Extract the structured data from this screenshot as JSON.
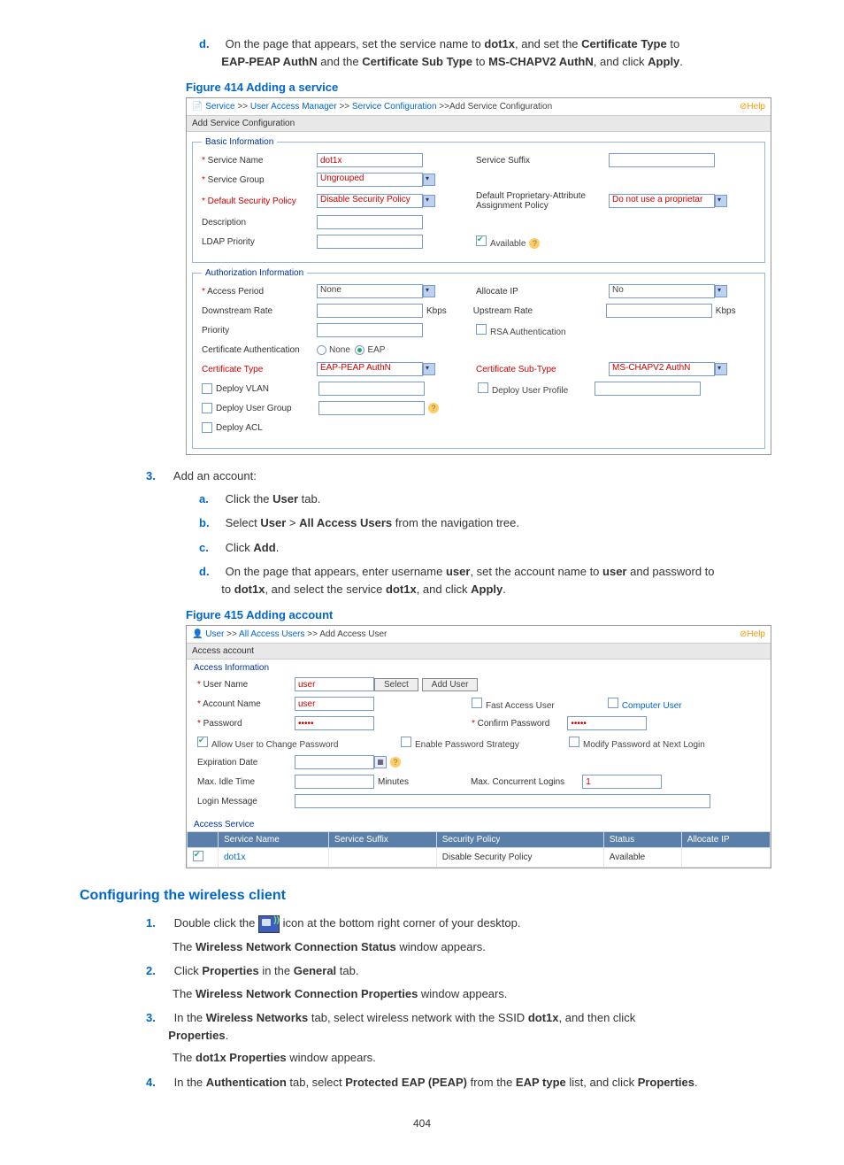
{
  "intro_d": {
    "marker": "d.",
    "t1": "On the page that appears, set the service name to ",
    "b1": "dot1x",
    "t2": ", and set the ",
    "b2": "Certificate Type",
    "t3": " to ",
    "b3": "EAP-PEAP AuthN",
    "t4": " and the ",
    "b4": "Certificate Sub Type",
    "t5": " to ",
    "b5": "MS-CHAPV2 AuthN",
    "t6": ", and click ",
    "b6": "Apply",
    "t7": "."
  },
  "fig414_title": "Figure 414 Adding a service",
  "fig414": {
    "bc": {
      "p0": "Service",
      "p1": "User Access Manager",
      "p2": "Service Configuration",
      "p3": "Add Service Configuration",
      "help": "⊘Help"
    },
    "hdr": "Add Service Configuration",
    "basic": {
      "legend": "Basic Information",
      "service_name_lbl": "Service Name",
      "service_name_val": "dot1x",
      "service_group_lbl": "Service Group",
      "service_group_val": "Ungrouped",
      "def_sec_lbl": "Default Security Policy",
      "def_sec_val": "Disable Security Policy",
      "desc_lbl": "Description",
      "ldap_lbl": "LDAP Priority",
      "suffix_lbl": "Service Suffix",
      "dpa_lbl": "Default Proprietary-Attribute Assignment Policy",
      "dpa_val": "Do not use a proprietar",
      "available_lbl": "Available"
    },
    "auth": {
      "legend": "Authorization Information",
      "access_period_lbl": "Access Period",
      "access_period_val": "None",
      "downstream_lbl": "Downstream Rate",
      "kbps": "Kbps",
      "priority_lbl": "Priority",
      "cert_auth_lbl": "Certificate Authentication",
      "none": "None",
      "eap": "EAP",
      "cert_type_lbl": "Certificate Type",
      "cert_type_val": "EAP-PEAP AuthN",
      "deploy_vlan_lbl": "Deploy VLAN",
      "deploy_ug_lbl": "Deploy User Group",
      "deploy_acl_lbl": "Deploy ACL",
      "allocate_ip_lbl": "Allocate IP",
      "allocate_ip_val": "No",
      "upstream_lbl": "Upstream Rate",
      "rsa_lbl": "RSA Authentication",
      "cert_sub_lbl": "Certificate Sub-Type",
      "cert_sub_val": "MS-CHAPV2 AuthN",
      "deploy_up_lbl": "Deploy User Profile"
    }
  },
  "step3": {
    "marker": "3.",
    "text": "Add an account:"
  },
  "s3a": {
    "m": "a.",
    "t1": "Click the ",
    "b1": "User",
    "t2": " tab."
  },
  "s3b": {
    "m": "b.",
    "t1": "Select ",
    "b1": "User",
    "gt": " > ",
    "b2": "All Access Users",
    "t2": " from the navigation tree."
  },
  "s3c": {
    "m": "c.",
    "t1": "Click ",
    "b1": "Add",
    "t2": "."
  },
  "s3d": {
    "m": "d.",
    "t1": "On the page that appears, enter username ",
    "b1": "user",
    "t2": ", set the account name to ",
    "b2": "user",
    "t3": " and password to ",
    "b3": "dot1x",
    "t4": ", and select the service ",
    "b4": "dot1x",
    "t5": ", and click ",
    "b5": "Apply",
    "t6": "."
  },
  "fig415_title": "Figure 415 Adding account",
  "fig415": {
    "bc": {
      "p0": "User",
      "p1": "All Access Users",
      "p2": "Add Access User",
      "help": "⊘Help"
    },
    "hdr": "Access account",
    "sect": "Access Information",
    "username_lbl": "User Name",
    "username_val": "user",
    "select_btn": "Select",
    "add_btn": "Add User",
    "account_lbl": "Account Name",
    "account_val": "user",
    "fast_lbl": "Fast Access User",
    "comp_lbl": "Computer User",
    "pw_lbl": "Password",
    "pw_val": "•••••",
    "cpw_lbl": "Confirm Password",
    "cpw_val": "•••••",
    "allow_lbl": "Allow User to Change Password",
    "enable_lbl": "Enable Password Strategy",
    "modify_lbl": "Modify Password at Next Login",
    "exp_lbl": "Expiration Date",
    "idle_lbl": "Max. Idle Time",
    "idle_unit": "Minutes",
    "concurrent_lbl": "Max. Concurrent Logins",
    "concurrent_val": "1",
    "login_msg_lbl": "Login Message",
    "svc_sect": "Access Service",
    "th": {
      "name": "Service Name",
      "suffix": "Service Suffix",
      "policy": "Security Policy",
      "status": "Status",
      "alloc": "Allocate IP"
    },
    "row": {
      "name": "dot1x",
      "policy": "Disable Security Policy",
      "status": "Available"
    }
  },
  "h2": "Configuring the wireless client",
  "w1": {
    "m": "1.",
    "t1": "Double click the ",
    "t2": " icon at the bottom right corner of your desktop."
  },
  "w1r": {
    "t1": "The ",
    "b1": "Wireless Network Connection Status",
    "t2": " window appears."
  },
  "w2": {
    "m": "2.",
    "t1": "Click ",
    "b1": "Properties",
    "t2": " in the ",
    "b2": "General",
    "t3": " tab."
  },
  "w2r": {
    "t1": "The ",
    "b1": "Wireless Network Connection Properties",
    "t2": " window appears."
  },
  "w3": {
    "m": "3.",
    "t1": "In the ",
    "b1": "Wireless Networks",
    "t2": " tab, select wireless network with the SSID ",
    "b2": "dot1x",
    "t3": ", and then click ",
    "b3": "Properties",
    "t4": "."
  },
  "w3r": {
    "t1": "The ",
    "b1": "dot1x Properties",
    "t2": " window appears."
  },
  "w4": {
    "m": "4.",
    "t1": "In the ",
    "b1": "Authentication",
    "t2": " tab, select ",
    "b2": "Protected EAP (PEAP)",
    "t3": " from the ",
    "b3": "EAP type",
    "t4": " list, and click ",
    "b4": "Properties",
    "t5": "."
  },
  "page": "404"
}
